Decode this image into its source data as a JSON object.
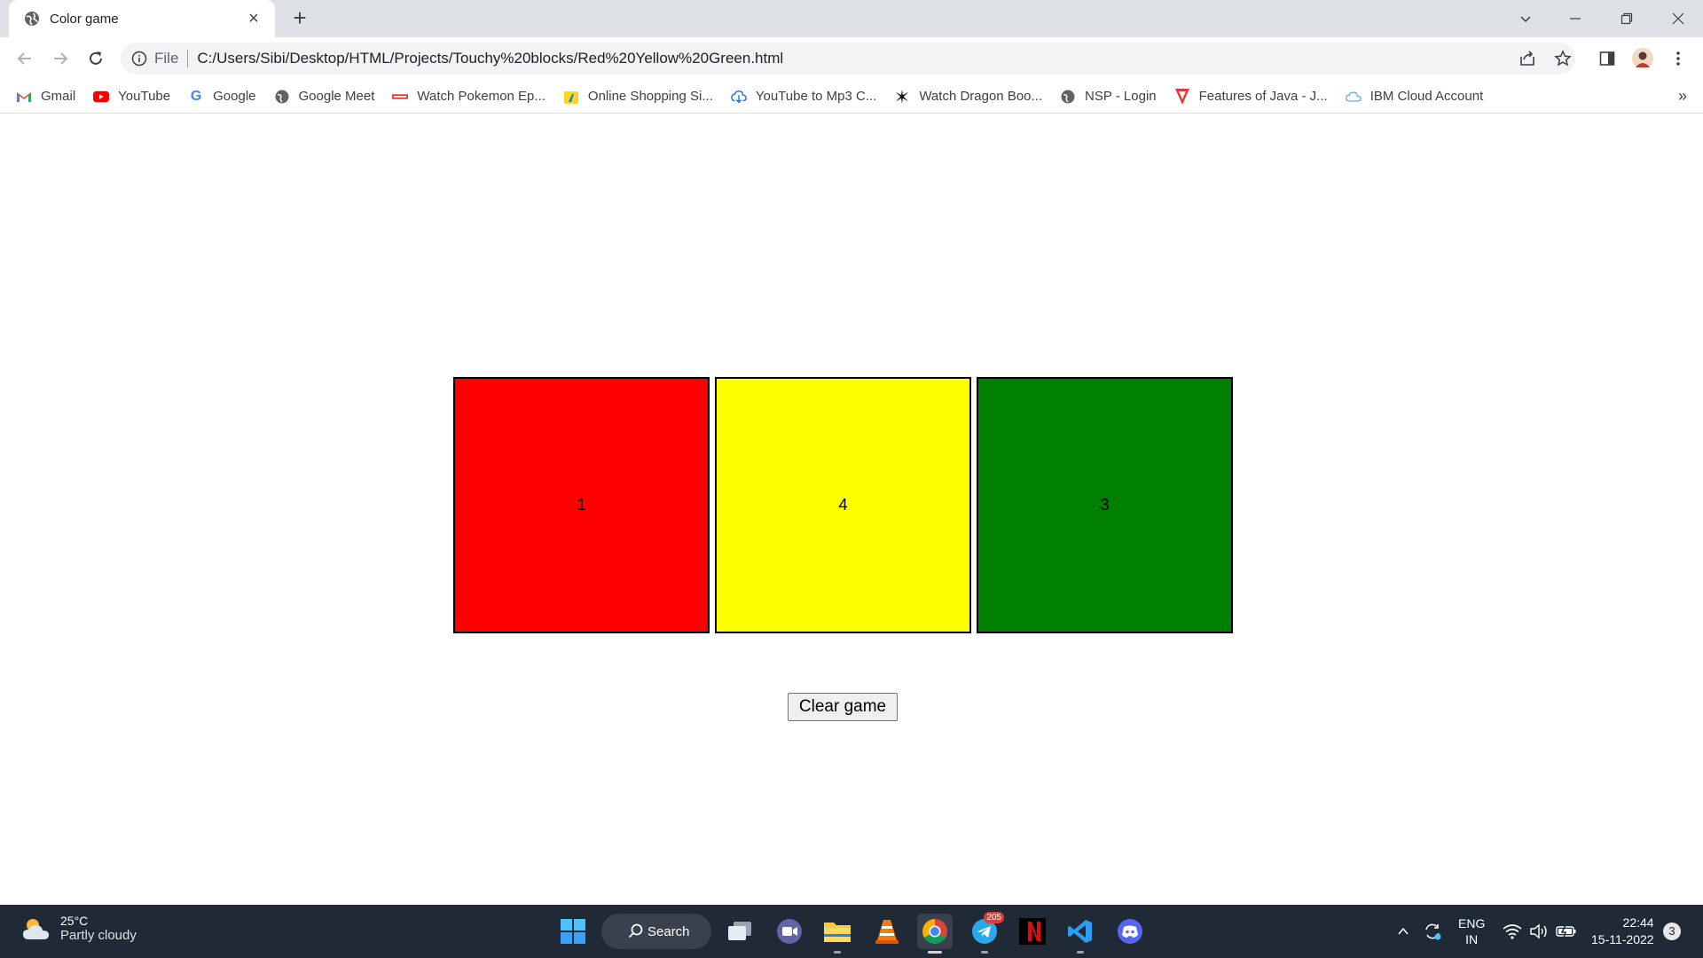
{
  "browser": {
    "tab_title": "Color game",
    "address_scheme": "File",
    "address_url": "C:/Users/Sibi/Desktop/HTML/Projects/Touchy%20blocks/Red%20Yellow%20Green.html"
  },
  "bookmarks": [
    {
      "label": "Gmail",
      "icon": "gmail-icon"
    },
    {
      "label": "YouTube",
      "icon": "youtube-icon"
    },
    {
      "label": "Google",
      "icon": "google-icon"
    },
    {
      "label": "Google Meet",
      "icon": "globe-icon"
    },
    {
      "label": "Watch Pokemon Ep...",
      "icon": "site-icon"
    },
    {
      "label": "Online Shopping Si...",
      "icon": "flipkart-icon"
    },
    {
      "label": "YouTube to Mp3 C...",
      "icon": "download-icon"
    },
    {
      "label": "Watch Dragon Boo...",
      "icon": "star-icon"
    },
    {
      "label": "NSP - Login",
      "icon": "globe-icon"
    },
    {
      "label": "Features of Java - J...",
      "icon": "site-icon"
    },
    {
      "label": "IBM Cloud Account",
      "icon": "cloud-icon"
    }
  ],
  "game": {
    "blocks": [
      {
        "label": "1",
        "color": "#ff0000"
      },
      {
        "label": "4",
        "color": "#ffff00"
      },
      {
        "label": "3",
        "color": "#008000"
      }
    ],
    "clear_label": "Clear game"
  },
  "taskbar": {
    "weather_temp": "25°C",
    "weather_condition": "Partly cloudy",
    "search_label": "Search",
    "lang_top": "ENG",
    "lang_bottom": "IN",
    "time": "22:44",
    "date": "15-11-2022",
    "notification_count": "3",
    "telegram_badge": "205"
  }
}
